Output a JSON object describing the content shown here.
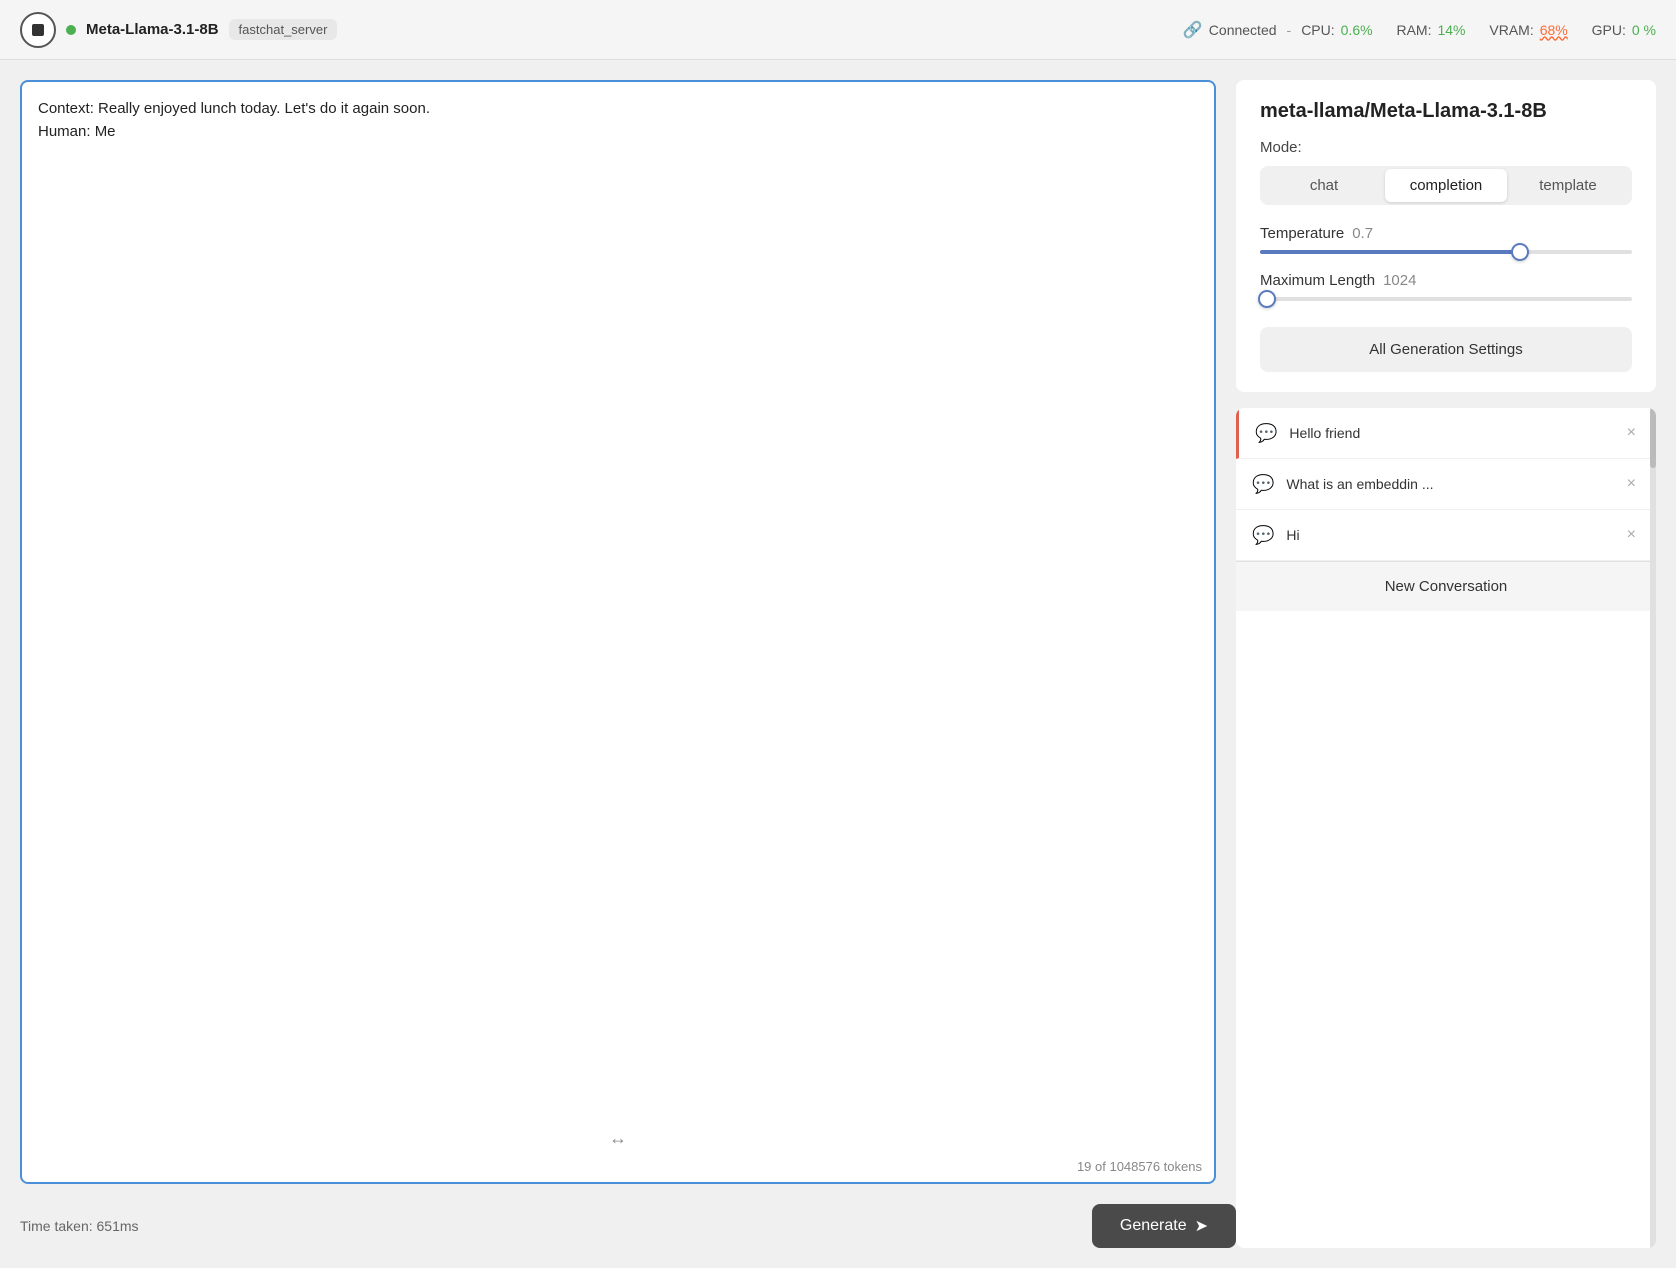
{
  "topbar": {
    "stop_button_label": "stop",
    "model_name": "Meta-Llama-3.1-8B",
    "server": "fastchat_server",
    "connection_status": "Connected",
    "cpu_label": "CPU:",
    "cpu_value": "0.6%",
    "ram_label": "RAM:",
    "ram_value": "14%",
    "vram_label": "VRAM:",
    "vram_value": "68%",
    "gpu_label": "GPU:",
    "gpu_value": "0 %"
  },
  "left_panel": {
    "prompt_text": "Context: Really enjoyed lunch today. Let's do it again soon.\nHuman: Me",
    "token_count": "19 of 1048576 tokens",
    "time_taken": "Time taken: 651ms",
    "generate_label": "Generate"
  },
  "right_panel": {
    "model_title": "meta-llama/Meta-Llama-3.1-8B",
    "mode_label": "Mode:",
    "modes": [
      {
        "id": "chat",
        "label": "chat"
      },
      {
        "id": "completion",
        "label": "completion"
      },
      {
        "id": "template",
        "label": "template"
      }
    ],
    "active_mode": "completion",
    "temperature": {
      "label": "Temperature",
      "value": "0.7",
      "percent": 70
    },
    "max_length": {
      "label": "Maximum Length",
      "value": "1024",
      "percent": 2
    },
    "all_settings_label": "All Generation Settings"
  },
  "conversations": {
    "items": [
      {
        "id": "conv-1",
        "title": "Hello friend",
        "active": true
      },
      {
        "id": "conv-2",
        "title": "What is an embeddin ...",
        "active": false
      },
      {
        "id": "conv-3",
        "title": "Hi",
        "active": false
      }
    ],
    "new_conv_label": "New Conversation"
  }
}
